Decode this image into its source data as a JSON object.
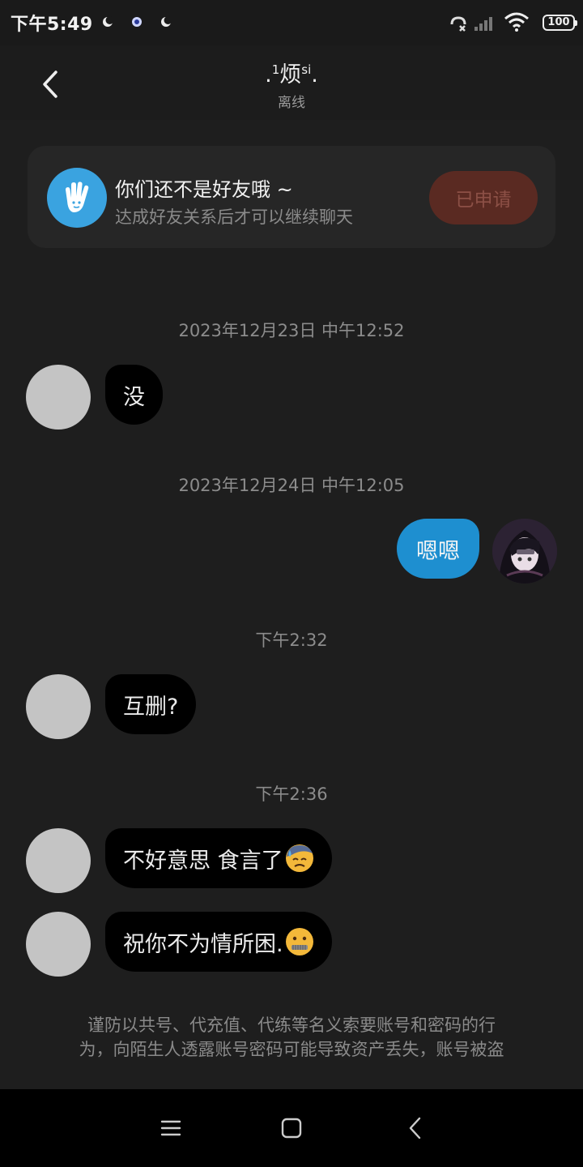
{
  "status_bar": {
    "time": "下午5:49",
    "battery": "100"
  },
  "header": {
    "title_prefix": ".",
    "title_sup1": "1",
    "title_main": "烦",
    "title_sup2": "si",
    "title_suffix": ".",
    "subtitle": "离线"
  },
  "friend_banner": {
    "title": "你们还不是好友哦 ~",
    "subtitle": "达成好友关系后才可以继续聊天",
    "button_label": "已申请"
  },
  "messages": {
    "ts1": "2023年12月23日 中午12:52",
    "m1": "没",
    "ts2": "2023年12月24日 中午12:05",
    "m2": "嗯嗯",
    "ts3": "下午2:32",
    "m3": "互删?",
    "ts4": "下午2:36",
    "m4": "不好意思 食言了",
    "m5": "祝你不为情所困."
  },
  "notice": {
    "line1": "谨防以共号、代充值、代练等名义索要账号和密码的行",
    "line2": "为，向陌生人透露账号密码可能导致资产丢失，账号被盗"
  },
  "icons": {
    "m4_emoji": "downcast-sweat-emoji",
    "m5_emoji": "zipper-mouth-emoji"
  },
  "colors": {
    "accent": "#1e8fd0",
    "applied_button": "#5a2a22",
    "background": "#1e1e1e"
  }
}
